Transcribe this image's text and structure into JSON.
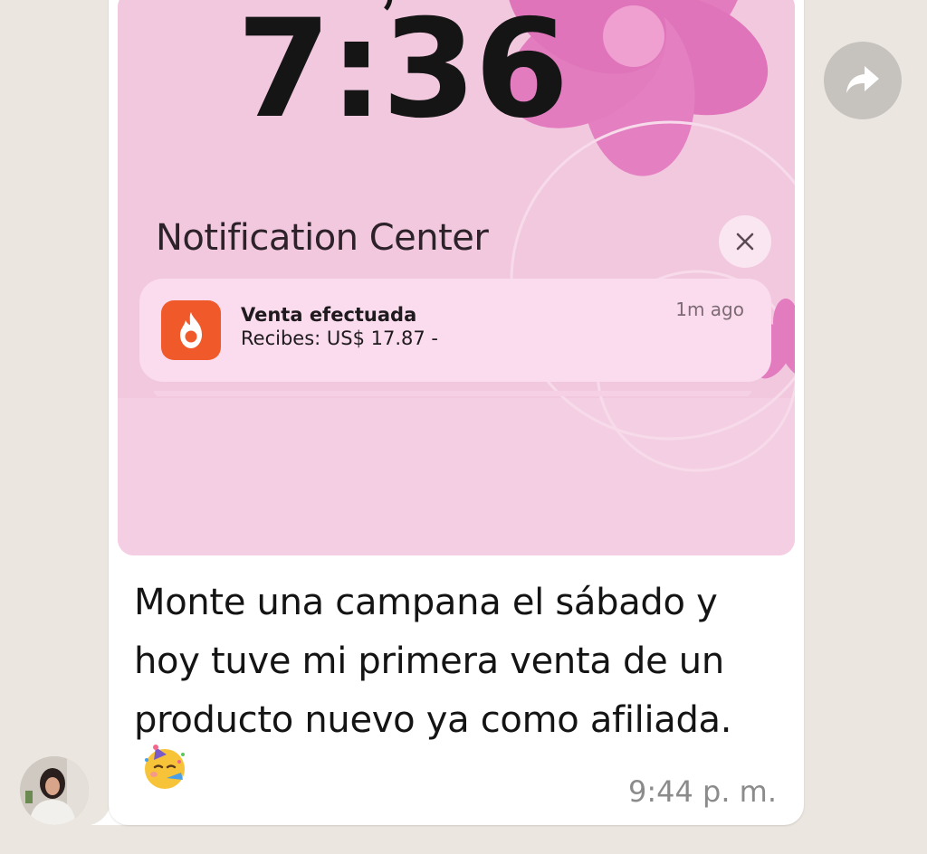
{
  "chat": {
    "message_text": "Monte una campana el sábado y hoy tuve mi primera venta de un producto nuevo ya como afiliada.",
    "timestamp": "9:44 p. m."
  },
  "lockscreen": {
    "time": "7:36",
    "notification_center_title": "Notification Center",
    "notification": {
      "title": "Venta efectuada",
      "body": "Recibes: US$ 17.87 - ",
      "time_ago": "1m ago"
    }
  },
  "icons": {
    "forward": "forward-arrow-icon",
    "close": "close-icon",
    "app": "fire-app-icon",
    "emoji": "partying-face-emoji"
  },
  "colors": {
    "chat_background": "#ebe6df",
    "bubble": "#ffffff",
    "wallpaper_pink": "#f1c6de",
    "flower_pink": "#e07bbd",
    "app_icon_orange": "#f05a2a"
  }
}
